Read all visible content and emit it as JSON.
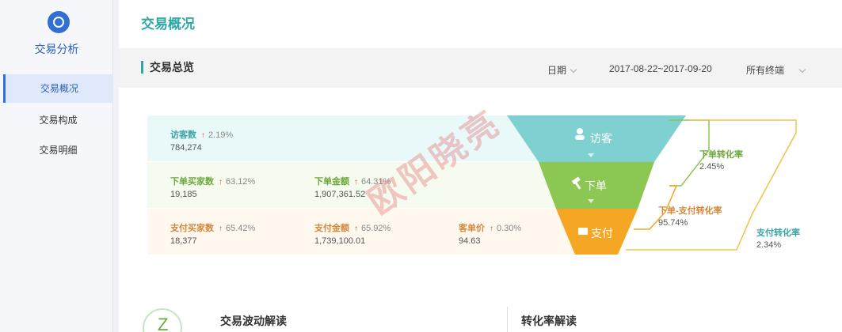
{
  "sidebar": {
    "title": "交易分析",
    "items": [
      {
        "label": "交易概况"
      },
      {
        "label": "交易构成"
      },
      {
        "label": "交易明细"
      }
    ]
  },
  "page": {
    "title": "交易概况"
  },
  "section": {
    "title": "交易总览",
    "date_label": "日期",
    "date_range": "2017-08-22~2017-09-20",
    "terminal": "所有终端"
  },
  "stats": {
    "visitors": {
      "label": "访客数",
      "change": "2.19%",
      "value": "784,274"
    },
    "order_buyers": {
      "label": "下单买家数",
      "change": "63.12%",
      "value": "19,185"
    },
    "order_amount": {
      "label": "下单金额",
      "change": "64.31%",
      "value": "1,907,361.52"
    },
    "pay_buyers": {
      "label": "支付买家数",
      "change": "65.42%",
      "value": "18,377"
    },
    "pay_amount": {
      "label": "支付金额",
      "change": "65.92%",
      "value": "1,739,100.01"
    },
    "unit_price": {
      "label": "客单价",
      "change": "0.30%",
      "value": "94.63"
    }
  },
  "funnel": {
    "visitor": "访客",
    "order": "下单",
    "pay": "支付",
    "order_rate_label": "下单转化率",
    "order_rate": "2.45%",
    "order_pay_rate_label": "下单-支付转化率",
    "order_pay_rate": "95.74%",
    "pay_rate_label": "支付转化率",
    "pay_rate": "2.34%",
    "colors": {
      "teal": "#7fd1d1",
      "green": "#8cc653",
      "orange": "#f5a623"
    }
  },
  "bottom": {
    "left_title": "交易波动解读",
    "right_title": "转化率解读",
    "badge": "Z"
  },
  "watermark": "欧阳晓亮"
}
